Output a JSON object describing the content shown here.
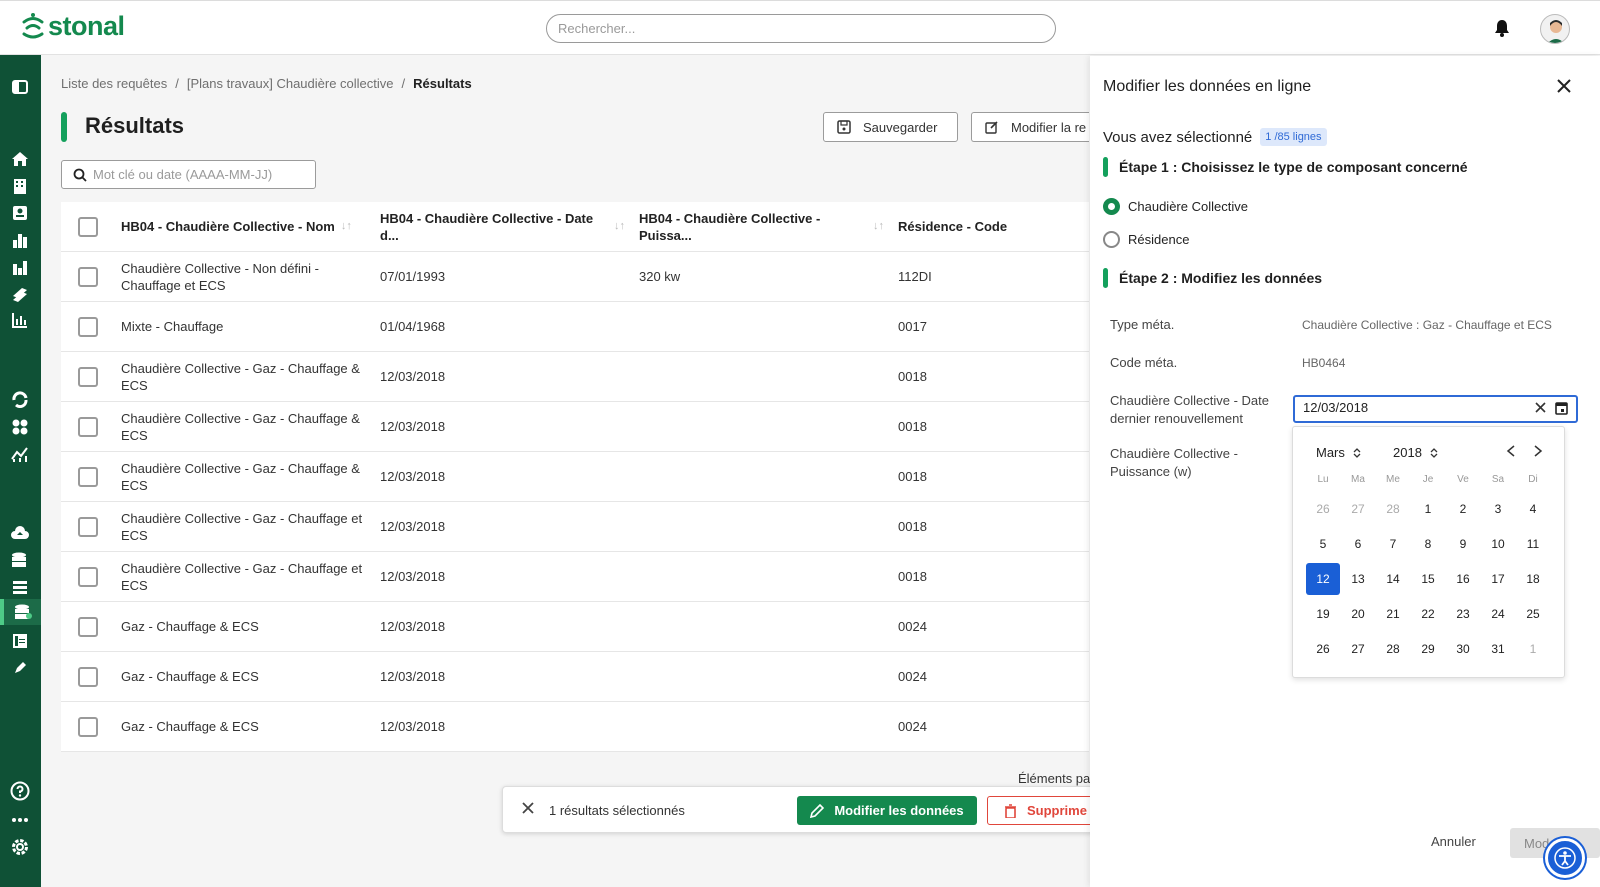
{
  "header": {
    "brand": "stonal",
    "search_placeholder": "Rechercher..."
  },
  "breadcrumb": {
    "items": [
      "Liste des requêtes",
      "[Plans travaux] Chaudière collective"
    ],
    "separator": "/",
    "current": "Résultats"
  },
  "page": {
    "title": "Résultats",
    "save_label": "Sauvegarder",
    "modify_label": "Modifier la re",
    "filter_placeholder": "Mot clé ou date (AAAA-MM-JJ)"
  },
  "table": {
    "columns": [
      "HB04 - Chaudière Collective - Nom",
      "HB04 - Chaudière Collective - Date d...",
      "HB04 - Chaudière Collective - Puissa...",
      "Résidence - Code"
    ],
    "rows": [
      {
        "nom": "Chaudière Collective - Non défini - Chauffage et ECS",
        "date": "07/01/1993",
        "puissance": "320 kw",
        "code": "112DI"
      },
      {
        "nom": "Mixte - Chauffage",
        "date": "01/04/1968",
        "puissance": "",
        "code": "0017"
      },
      {
        "nom": "Chaudière Collective - Gaz - Chauffage & ECS",
        "date": "12/03/2018",
        "puissance": "",
        "code": "0018"
      },
      {
        "nom": "Chaudière Collective - Gaz - Chauffage & ECS",
        "date": "12/03/2018",
        "puissance": "",
        "code": "0018"
      },
      {
        "nom": "Chaudière Collective - Gaz - Chauffage & ECS",
        "date": "12/03/2018",
        "puissance": "",
        "code": "0018"
      },
      {
        "nom": "Chaudière Collective - Gaz - Chauffage et ECS",
        "date": "12/03/2018",
        "puissance": "",
        "code": "0018"
      },
      {
        "nom": "Chaudière Collective - Gaz - Chauffage et ECS",
        "date": "12/03/2018",
        "puissance": "",
        "code": "0018"
      },
      {
        "nom": "Gaz - Chauffage & ECS",
        "date": "12/03/2018",
        "puissance": "",
        "code": "0024"
      },
      {
        "nom": "Gaz - Chauffage & ECS",
        "date": "12/03/2018",
        "puissance": "",
        "code": "0024"
      },
      {
        "nom": "Gaz - Chauffage & ECS",
        "date": "12/03/2018",
        "puissance": "",
        "code": "0024"
      }
    ],
    "pager_label": "Éléments pa"
  },
  "selection_bar": {
    "text": "1 résultats sélectionnés",
    "modify_label": "Modifier les données",
    "delete_label": "Supprime"
  },
  "panel": {
    "title": "Modifier les données en ligne",
    "selected_label": "Vous avez sélectionné",
    "selected_badge": "1 /85 lignes",
    "step1": "Étape 1 : Choisissez le type de composant concerné",
    "options": [
      "Chaudière Collective",
      "Résidence"
    ],
    "selected_option": "Chaudière Collective",
    "step2": "Étape 2 : Modifiez les données",
    "fields": [
      {
        "label": "Type méta.",
        "value": "Chaudière Collective : Gaz - Chauffage et ECS"
      },
      {
        "label": "Code méta.",
        "value": "HB0464"
      },
      {
        "label": "Chaudière Collective - Date dernier renouvellement",
        "value": "12/03/2018"
      },
      {
        "label": "Chaudière Collective - Puissance (w)",
        "value": ""
      }
    ],
    "cancel_label": "Annuler",
    "apply_label": "Mod"
  },
  "calendar": {
    "month": "Mars",
    "year": "2018",
    "weekdays": [
      "Lu",
      "Ma",
      "Me",
      "Je",
      "Ve",
      "Sa",
      "Di"
    ],
    "weeks": [
      [
        "26",
        "27",
        "28",
        "1",
        "2",
        "3",
        "4"
      ],
      [
        "5",
        "6",
        "7",
        "8",
        "9",
        "10",
        "11"
      ],
      [
        "12",
        "13",
        "14",
        "15",
        "16",
        "17",
        "18"
      ],
      [
        "19",
        "20",
        "21",
        "22",
        "23",
        "24",
        "25"
      ],
      [
        "26",
        "27",
        "28",
        "29",
        "30",
        "31",
        "1"
      ]
    ],
    "selected_day": "12"
  },
  "colors": {
    "brand_green": "#14894e",
    "sidebar": "#0f5136",
    "accent_blue": "#1a5fd6",
    "danger": "#e0463b"
  }
}
